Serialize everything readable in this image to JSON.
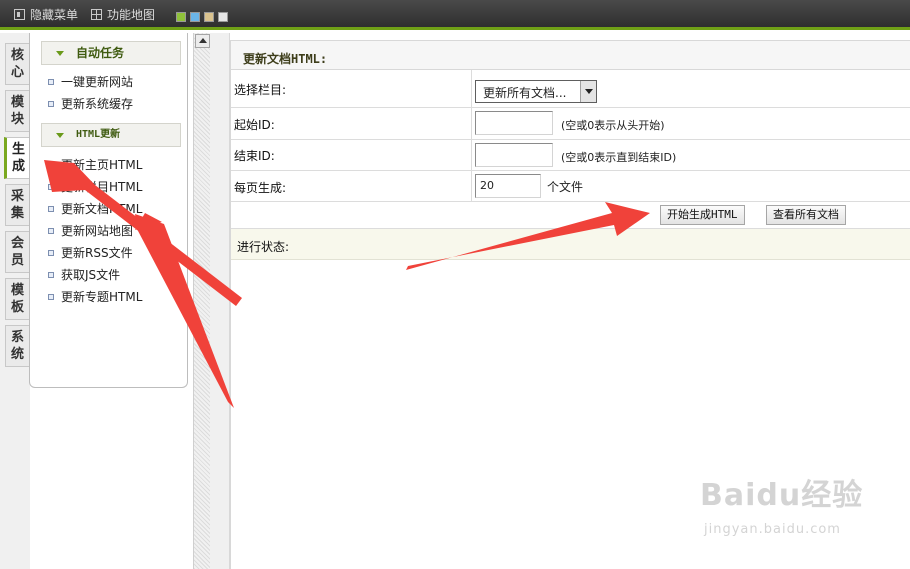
{
  "topbar": {
    "hide_menu_label": "隐藏菜单",
    "site_map_label": "功能地图",
    "skin_colors": [
      "#8fc13a",
      "#6bb5e8",
      "#d9c28e",
      "#e6e6e6"
    ]
  },
  "tabs": [
    {
      "label": "核心",
      "active": false
    },
    {
      "label": "模块",
      "active": false
    },
    {
      "label": "生成",
      "active": true
    },
    {
      "label": "采集",
      "active": false
    },
    {
      "label": "会员",
      "active": false
    },
    {
      "label": "模板",
      "active": false
    },
    {
      "label": "系统",
      "active": false
    }
  ],
  "menu": {
    "group1_title": "自动任务",
    "group1_items": [
      "一键更新网站",
      "更新系统缓存"
    ],
    "group2_title": "HTML更新",
    "group2_items": [
      "更新主页HTML",
      "更新栏目HTML",
      "更新文档HTML",
      "更新网站地图",
      "更新RSS文件",
      "获取JS文件",
      "更新专题HTML"
    ]
  },
  "main": {
    "title": "更新文档HTML:",
    "select_label": "选择栏目:",
    "select_value": "更新所有文档...",
    "start_label": "起始ID:",
    "start_value": "",
    "start_hint": "(空或0表示从头开始)",
    "end_label": "结束ID:",
    "end_value": "",
    "end_hint": "(空或0表示直到结束ID)",
    "per_page_label": "每页生成:",
    "per_page_value": "20",
    "per_page_unit": "个文件",
    "start_button": "开始生成HTML",
    "view_button": "查看所有文档",
    "status_label": "进行状态:"
  },
  "watermark": {
    "text": "Baidu经验",
    "sub": "jingyan.baidu.com"
  },
  "annotation_color": "#f0423a"
}
